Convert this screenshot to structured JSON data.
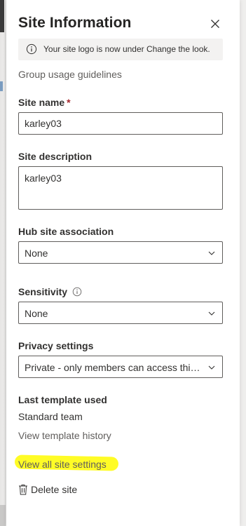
{
  "panel": {
    "title": "Site Information",
    "info_message": "Your site logo is now under Change the look.",
    "group_usage_link": "Group usage guidelines"
  },
  "site_name": {
    "label": "Site name",
    "required_marker": "*",
    "value": "karley03"
  },
  "site_description": {
    "label": "Site description",
    "value": "karley03"
  },
  "hub_association": {
    "label": "Hub site association",
    "selected": "None"
  },
  "sensitivity": {
    "label": "Sensitivity",
    "selected": "None"
  },
  "privacy": {
    "label": "Privacy settings",
    "selected": "Private - only members can access this site"
  },
  "template": {
    "label": "Last template used",
    "value": "Standard team",
    "history_link": "View template history"
  },
  "links": {
    "view_all_settings": "View all site settings",
    "delete_site": "Delete site"
  },
  "colors": {
    "panel_bg": "#ffffff",
    "link": "#605e5c",
    "required": "#a4262c",
    "highlight": "#fffb00",
    "border": "#605e5c"
  },
  "icons": [
    "close-icon",
    "info-icon",
    "chevron-down-icon",
    "trash-icon"
  ]
}
